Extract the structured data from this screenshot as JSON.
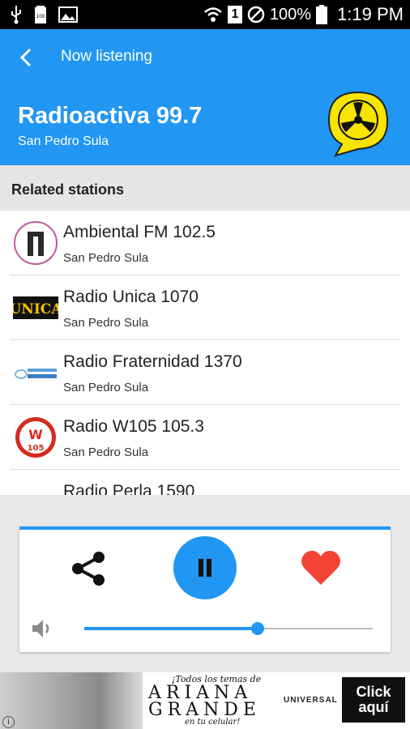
{
  "status_bar": {
    "battery": "100%",
    "time": "1:19 PM",
    "sim": "1",
    "icons": [
      "usb-icon",
      "battery-full-icon",
      "image-icon",
      "wifi-icon",
      "sim-icon",
      "blocked-icon",
      "battery-icon"
    ]
  },
  "toolbar": {
    "title": "Now listening"
  },
  "now_playing": {
    "name": "Radioactiva 99.7",
    "city": "San Pedro Sula"
  },
  "related": {
    "title": "Related stations",
    "items": [
      {
        "name": "Ambiental FM 102.5",
        "city": "San Pedro Sula",
        "logo": "ambiental-logo"
      },
      {
        "name": "Radio Unica 1070",
        "city": "San Pedro Sula",
        "logo": "unica-logo"
      },
      {
        "name": "Radio Fraternidad 1370",
        "city": "San Pedro Sula",
        "logo": "fraternidad-logo"
      },
      {
        "name": "Radio W105 105.3",
        "city": "San Pedro Sula",
        "logo": "w105-logo"
      },
      {
        "name": "Radio Perla 1590",
        "city": "",
        "logo": ""
      }
    ]
  },
  "player": {
    "volume": 0.6,
    "state": "playing"
  },
  "ad": {
    "line1": "¡Todos los temas de",
    "artist_line1": "ARIANA",
    "artist_line2": "GRANDE",
    "line3": "en tu celular!",
    "label": "UNIVERSAL",
    "cta": "Click aquí"
  },
  "colors": {
    "primary": "#2196f3",
    "heart": "#f44336"
  }
}
